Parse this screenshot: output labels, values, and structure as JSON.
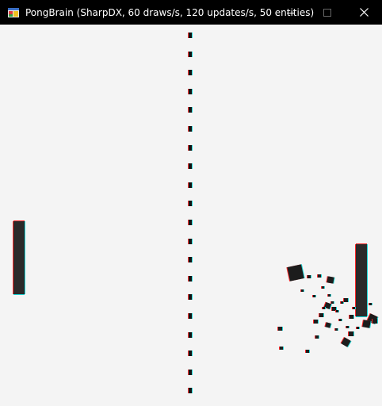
{
  "window": {
    "title": "PongBrain (SharpDX, 60 draws/s, 120 updates/s, 50 entities)",
    "icon": "app-window-icon",
    "controls": {
      "minimize_icon": "minimize-icon",
      "maximize_icon": "maximize-icon",
      "close_icon": "close-icon"
    }
  },
  "game": {
    "background_color": "#f4f4f4",
    "entity_color": "#1c1c1c",
    "fringe_colors": [
      "#ff2a2a",
      "#19d6d6"
    ],
    "net": {
      "style": "dashed",
      "segments": 20
    },
    "paddles": [
      {
        "side": "left"
      },
      {
        "side": "right"
      }
    ],
    "ball_fragments": 34
  }
}
